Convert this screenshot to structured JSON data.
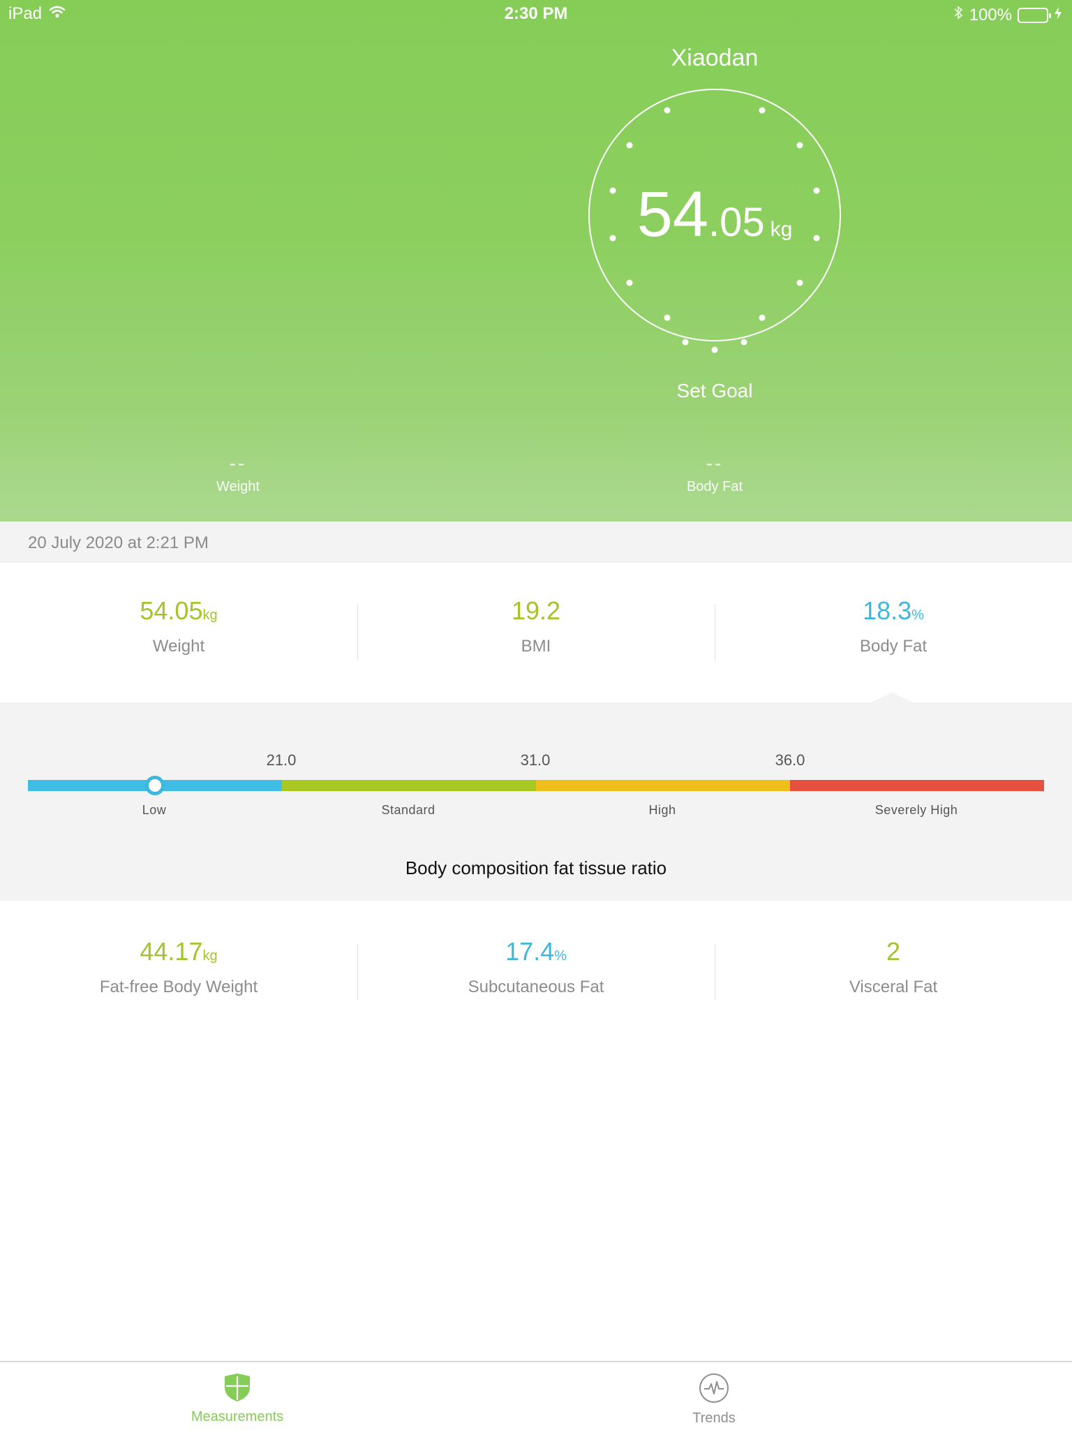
{
  "status_bar": {
    "device": "iPad",
    "time": "2:30 PM",
    "battery": "100%"
  },
  "profile": {
    "name": "Xiaodan"
  },
  "current_weight": {
    "integer": "54",
    "decimal": ".05",
    "unit": "kg"
  },
  "goal": {
    "label": "Set Goal"
  },
  "summary": {
    "weight_value": "--",
    "weight_label": "Weight",
    "fat_value": "--",
    "fat_label": "Body Fat"
  },
  "measurement": {
    "date": "20 July 2020 at 2:21 PM"
  },
  "metrics_row1": [
    {
      "value": "54.05",
      "unit": "kg",
      "label": "Weight"
    },
    {
      "value": "19.2",
      "unit": "",
      "label": "BMI"
    },
    {
      "value": "18.3",
      "unit": "%",
      "label": "Body Fat"
    }
  ],
  "range": {
    "thresholds": [
      "21.0",
      "31.0",
      "36.0"
    ],
    "categories": [
      "Low",
      "Standard",
      "High",
      "Severely High"
    ],
    "colors": [
      "#3fbde6",
      "#a7c922",
      "#f0be1a",
      "#e5503f"
    ],
    "marker_value": 18.3,
    "caption": "Body composition fat tissue ratio"
  },
  "metrics_row2": [
    {
      "value": "44.17",
      "unit": "kg",
      "label": "Fat-free Body Weight"
    },
    {
      "value": "17.4",
      "unit": "%",
      "label": "Subcutaneous Fat"
    },
    {
      "value": "2",
      "unit": "",
      "label": "Visceral Fat"
    }
  ],
  "tabs": [
    {
      "label": "Measurements",
      "icon": "shield-icon",
      "active": true
    },
    {
      "label": "Trends",
      "icon": "heartbeat-icon",
      "active": false
    }
  ],
  "colors": {
    "brand_green": "#86cd58",
    "value_green": "#a3c42a",
    "value_blue": "#3fb7dc"
  }
}
